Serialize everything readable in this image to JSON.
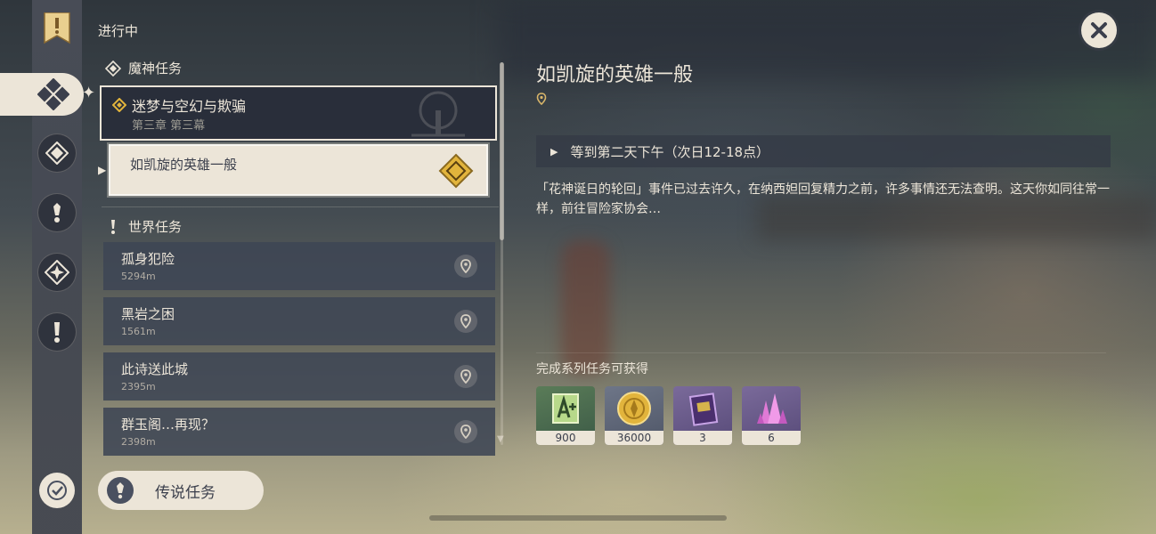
{
  "header": {
    "status_label": "进行中"
  },
  "colors": {
    "panel_light": "#ece5d8",
    "panel_dark": "#2f333d",
    "accent_gold": "#e2b43c",
    "text_dark": "#3b3f4c"
  },
  "sidebar": {
    "icons": [
      "quest-log-bookmark-icon",
      "archon-quest-icon",
      "story-quest-icon",
      "world-quest-icon",
      "commission-icon",
      "exclamation-icon",
      "achievement-icon"
    ]
  },
  "archon": {
    "group_title": "魔神任务",
    "quest_title": "迷梦与空幻与欺骗",
    "quest_subtitle": "第三章 第三幕",
    "active_step": "如凯旋的英雄一般"
  },
  "world": {
    "group_title": "世界任务",
    "quests": [
      {
        "name": "孤身犯险",
        "distance": "5294m"
      },
      {
        "name": "黑岩之困",
        "distance": "1561m"
      },
      {
        "name": "此诗送此城",
        "distance": "2395m"
      },
      {
        "name": "群玉阁…再现？",
        "distance": "2398m"
      }
    ]
  },
  "legend_button": {
    "label": "传说任务"
  },
  "detail": {
    "title": "如凯旋的英雄一般",
    "objective": "等到第二天下午（次日12-18点）",
    "description": "「花神诞日的轮回」事件已过去许久，在纳西妲回复精力之前，许多事情还无法查明。这天你如同往常一样，前往冒险家协会…",
    "rewards_label": "完成系列任务可获得",
    "rewards": [
      {
        "icon": "adventure-exp-icon",
        "count": "900"
      },
      {
        "icon": "mora-coin-icon",
        "count": "36000"
      },
      {
        "icon": "heros-wit-book-icon",
        "count": "3"
      },
      {
        "icon": "mystic-enhancement-ore-icon",
        "count": "6"
      }
    ]
  }
}
